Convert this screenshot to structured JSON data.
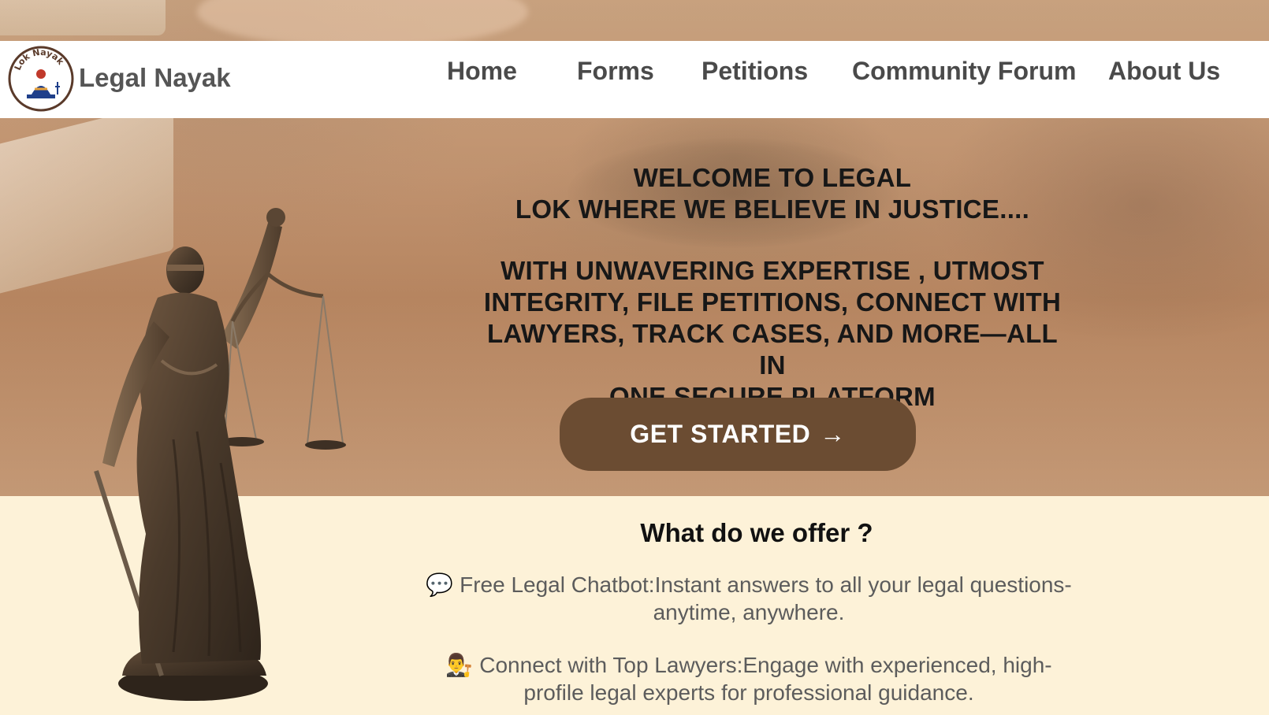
{
  "brand": {
    "name": "Legal Nayak",
    "logo_text": "Lok Nayak"
  },
  "nav": {
    "items": [
      {
        "label": "Home"
      },
      {
        "label": "Forms"
      },
      {
        "label": "Petitions"
      },
      {
        "label": "Community Forum"
      },
      {
        "label": "About Us"
      }
    ]
  },
  "hero": {
    "welcome_line1": "WELCOME TO LEGAL",
    "welcome_line2": "LOK WHERE WE BELIEVE IN JUSTICE....",
    "tagline_line1": "WITH UNWAVERING EXPERTISE , UTMOST",
    "tagline_line2": "INTEGRITY, FILE PETITIONS, CONNECT WITH",
    "tagline_line3": "LAWYERS, TRACK CASES, AND MORE—ALL IN",
    "tagline_line4": "ONE SECURE PLATFORM",
    "cta_label": "GET STARTED",
    "cta_arrow": "→"
  },
  "offer": {
    "title": "What do we offer ?",
    "items": [
      {
        "emoji": "💬",
        "line1": "Free Legal Chatbot:Instant answers to all your legal questions-",
        "line2": "anytime, anywhere."
      },
      {
        "emoji": "👨‍⚖️",
        "line1": "Connect with Top Lawyers:Engage with experienced, high-",
        "line2": "profile legal experts for professional guidance."
      }
    ]
  },
  "colors": {
    "cta_bg": "#6b4c32",
    "nav_bg": "#ffffff",
    "offer_bg": "#fdf2d8",
    "nav_text": "#4a4a4a"
  }
}
